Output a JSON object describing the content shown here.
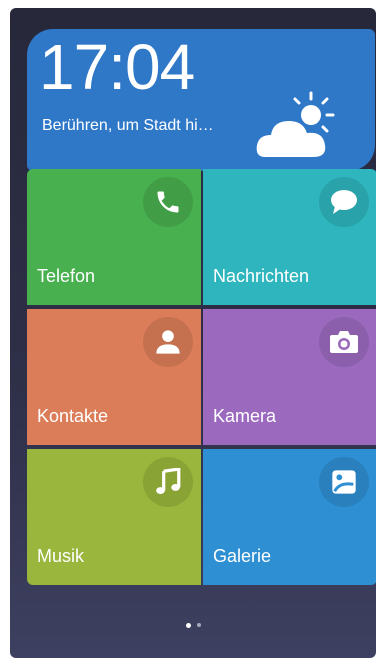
{
  "weather": {
    "time": "17:04",
    "city_hint": "Berühren, um Stadt hi…",
    "icon": "partly-cloudy-icon"
  },
  "tiles": [
    {
      "label": "Telefon",
      "icon": "phone-icon",
      "color": "#49b04f"
    },
    {
      "label": "Nachrichten",
      "icon": "message-icon",
      "color": "#2eb5bd"
    },
    {
      "label": "Kontakte",
      "icon": "contact-icon",
      "color": "#dc7d59"
    },
    {
      "label": "Kamera",
      "icon": "camera-icon",
      "color": "#9b6abf"
    },
    {
      "label": "Musik",
      "icon": "music-icon",
      "color": "#9ab63c"
    },
    {
      "label": "Galerie",
      "icon": "gallery-icon",
      "color": "#2e8fd3"
    }
  ],
  "pager": {
    "pages": 2,
    "current": 1
  }
}
